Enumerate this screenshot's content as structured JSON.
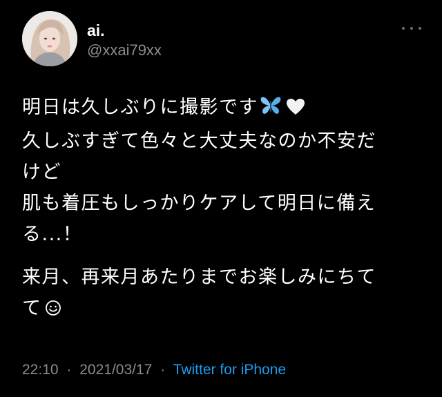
{
  "tweet": {
    "display_name": "ai.",
    "handle": "@xxai79xx",
    "avatar_icon": "profile-photo",
    "more_icon": "more-dots-icon",
    "lines": {
      "l1": "明日は久しぶりに撮影です",
      "l2": "久しぶすぎて色々と大丈夫なのか不安だ",
      "l3": "けど",
      "l4": "肌も着圧もしっかりケアして明日に備え",
      "l5": "る...！",
      "l6": "来月、再来月あたりまでお楽しみにちて",
      "l7": "て"
    },
    "emoji": {
      "butterfly": "butterfly-emoji",
      "heart": "white-heart-emoji",
      "smile": "smiling-face-symbol"
    },
    "time": "22:10",
    "date": "2021/03/17",
    "separator": "·",
    "source": "Twitter for iPhone",
    "colors": {
      "background": "#000000",
      "text": "#ffffff",
      "secondary": "#8a8d91",
      "link": "#1d9bf0"
    }
  }
}
